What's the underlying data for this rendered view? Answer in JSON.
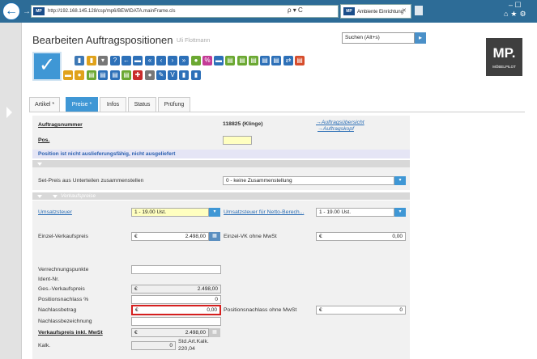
{
  "browser": {
    "address": "http://192.168.145.128/csp/mp6/BEWIDATA.mainFrame.cls",
    "address_tools": "ρ ▾ C",
    "tab_title": "Ambiente Einrichtung",
    "logo_text": "MP"
  },
  "header": {
    "title": "Bearbeiten Auftragspositionen",
    "user": "Uli Flottmann",
    "search_placeholder": "Suchen (Alt+s)",
    "logo_big": "MP.",
    "logo_small": "MÖBELPILOT"
  },
  "tabs": [
    {
      "label": "Artikel *",
      "active": false
    },
    {
      "label": "Preise *",
      "active": true
    },
    {
      "label": "Infos",
      "active": false
    },
    {
      "label": "Status",
      "active": false
    },
    {
      "label": "Prüfung",
      "active": false
    }
  ],
  "form": {
    "auftragsnummer_label": "Auftragsnummer",
    "auftragsnummer_value": "118825 (Klinge)",
    "link_uebersicht": "→Auftragsübersicht",
    "link_kopf": "→Auftragskopf",
    "pos_label": "Pos.",
    "pos_value": "",
    "notice": "Position ist nicht auslieferungsfähig, nicht ausgeliefert",
    "setpreis_label": "Set-Preis aus Unterteilen zusammenstellen",
    "setpreis_value": "0 - keine Zusammenstellung",
    "section_vk": "Verkaufspreise",
    "umsatzsteuer_label": "Umsatzsteuer",
    "umsatzsteuer_value": "1 - 19.00 Ust.",
    "umsatzsteuer_netto_label": "Umsatzsteuer für Netto-Berech...",
    "umsatzsteuer_netto_value": "1 - 19.00 Ust.",
    "einzel_vk_label": "Einzel-Verkaufspreis",
    "einzel_vk_currency": "€",
    "einzel_vk_value": "2.498,00",
    "einzel_vk_ohne_label": "Einzel-VK ohne MwSt",
    "einzel_vk_ohne_currency": "€",
    "einzel_vk_ohne_value": "0,00",
    "verrechnungspunkte_label": "Verrechnungspunkte",
    "ident_label": "Ident-Nr.",
    "ges_vk_label": "Ges.-Verkaufspreis",
    "ges_vk_currency": "€",
    "ges_vk_value": "2.498,00",
    "posnachlass_pct_label": "Positionsnachlass %",
    "posnachlass_pct_value": "0",
    "nachlassbetrag_label": "Nachlassbetrag",
    "nachlassbetrag_currency": "€",
    "nachlassbetrag_value": "0,00",
    "posnachlass_ohne_label": "Positionsnachlass ohne MwSt",
    "posnachlass_ohne_currency": "€",
    "posnachlass_ohne_value": "0",
    "nachlassbez_label": "Nachlassbezeichnung",
    "vk_inkl_label": "Verkaufspreis inkl. MwSt",
    "vk_inkl_currency": "€",
    "vk_inkl_value": "2.498,00",
    "kalk_label": "Kalk.",
    "kalk_value": "0",
    "kalk_std_label": "Std.Art.Kalk.",
    "kalk_std_value": "220,04"
  }
}
